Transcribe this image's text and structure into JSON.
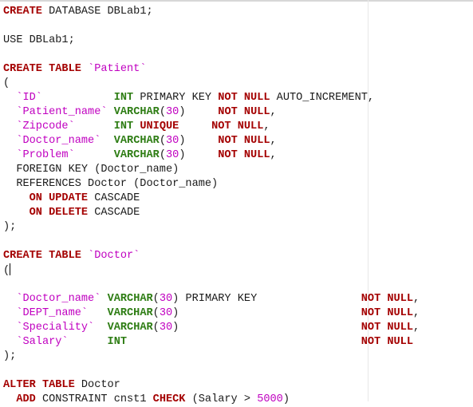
{
  "editor": {
    "colors": {
      "keyword": "#a40000",
      "type": "#2e7d14",
      "identifier": "#c000c0",
      "number": "#c000c0",
      "plain": "#1a1a1a"
    },
    "cursor_line": 19,
    "lines": [
      [
        [
          "k",
          "CREATE"
        ],
        [
          "p",
          " DATABASE DBLab1;"
        ]
      ],
      [],
      [
        [
          "p",
          "USE DBLab1;"
        ]
      ],
      [],
      [
        [
          "k",
          "CREATE TABLE"
        ],
        [
          "p",
          " "
        ],
        [
          "i",
          "`Patient`"
        ]
      ],
      [
        [
          "p",
          "("
        ]
      ],
      [
        [
          "p",
          "  "
        ],
        [
          "i",
          "`ID`"
        ],
        [
          "p",
          "           "
        ],
        [
          "t",
          "INT"
        ],
        [
          "p",
          " PRIMARY KEY "
        ],
        [
          "k",
          "NOT NULL"
        ],
        [
          "p",
          " AUTO_INCREMENT,"
        ]
      ],
      [
        [
          "p",
          "  "
        ],
        [
          "i",
          "`Patient_name`"
        ],
        [
          "p",
          " "
        ],
        [
          "t",
          "VARCHAR"
        ],
        [
          "p",
          "("
        ],
        [
          "n",
          "30"
        ],
        [
          "p",
          ")     "
        ],
        [
          "k",
          "NOT NULL"
        ],
        [
          "p",
          ","
        ]
      ],
      [
        [
          "p",
          "  "
        ],
        [
          "i",
          "`Zipcode`"
        ],
        [
          "p",
          "      "
        ],
        [
          "t",
          "INT"
        ],
        [
          "p",
          " "
        ],
        [
          "k",
          "UNIQUE"
        ],
        [
          "p",
          "     "
        ],
        [
          "k",
          "NOT NULL"
        ],
        [
          "p",
          ","
        ]
      ],
      [
        [
          "p",
          "  "
        ],
        [
          "i",
          "`Doctor_name`"
        ],
        [
          "p",
          "  "
        ],
        [
          "t",
          "VARCHAR"
        ],
        [
          "p",
          "("
        ],
        [
          "n",
          "30"
        ],
        [
          "p",
          ")     "
        ],
        [
          "k",
          "NOT NULL"
        ],
        [
          "p",
          ","
        ]
      ],
      [
        [
          "p",
          "  "
        ],
        [
          "i",
          "`Problem`"
        ],
        [
          "p",
          "      "
        ],
        [
          "t",
          "VARCHAR"
        ],
        [
          "p",
          "("
        ],
        [
          "n",
          "30"
        ],
        [
          "p",
          ")     "
        ],
        [
          "k",
          "NOT NULL"
        ],
        [
          "p",
          ","
        ]
      ],
      [
        [
          "p",
          "  FOREIGN KEY (Doctor_name)"
        ]
      ],
      [
        [
          "p",
          "  REFERENCES Doctor (Doctor_name)"
        ]
      ],
      [
        [
          "p",
          "    "
        ],
        [
          "k",
          "ON UPDATE"
        ],
        [
          "p",
          " CASCADE"
        ]
      ],
      [
        [
          "p",
          "    "
        ],
        [
          "k",
          "ON DELETE"
        ],
        [
          "p",
          " CASCADE"
        ]
      ],
      [
        [
          "p",
          ");"
        ]
      ],
      [],
      [
        [
          "k",
          "CREATE TABLE"
        ],
        [
          "p",
          " "
        ],
        [
          "i",
          "`Doctor`"
        ]
      ],
      [
        [
          "p",
          "("
        ]
      ],
      [],
      [
        [
          "p",
          "  "
        ],
        [
          "i",
          "`Doctor_name`"
        ],
        [
          "p",
          " "
        ],
        [
          "t",
          "VARCHAR"
        ],
        [
          "p",
          "("
        ],
        [
          "n",
          "30"
        ],
        [
          "p",
          ") PRIMARY KEY                "
        ],
        [
          "k",
          "NOT NULL"
        ],
        [
          "p",
          ","
        ]
      ],
      [
        [
          "p",
          "  "
        ],
        [
          "i",
          "`DEPT_name`"
        ],
        [
          "p",
          "   "
        ],
        [
          "t",
          "VARCHAR"
        ],
        [
          "p",
          "("
        ],
        [
          "n",
          "30"
        ],
        [
          "p",
          ")                            "
        ],
        [
          "k",
          "NOT NULL"
        ],
        [
          "p",
          ","
        ]
      ],
      [
        [
          "p",
          "  "
        ],
        [
          "i",
          "`Speciality`"
        ],
        [
          "p",
          "  "
        ],
        [
          "t",
          "VARCHAR"
        ],
        [
          "p",
          "("
        ],
        [
          "n",
          "30"
        ],
        [
          "p",
          ")                            "
        ],
        [
          "k",
          "NOT NULL"
        ],
        [
          "p",
          ","
        ]
      ],
      [
        [
          "p",
          "  "
        ],
        [
          "i",
          "`Salary`"
        ],
        [
          "p",
          "      "
        ],
        [
          "t",
          "INT"
        ],
        [
          "p",
          "                                    "
        ],
        [
          "k",
          "NOT NULL"
        ]
      ],
      [
        [
          "p",
          ");"
        ]
      ],
      [],
      [
        [
          "k",
          "ALTER TABLE"
        ],
        [
          "p",
          " Doctor"
        ]
      ],
      [
        [
          "p",
          "  "
        ],
        [
          "k",
          "ADD"
        ],
        [
          "p",
          " CONSTRAINT cnst1 "
        ],
        [
          "k",
          "CHECK"
        ],
        [
          "p",
          " (Salary > "
        ],
        [
          "n",
          "5000"
        ],
        [
          "p",
          ")"
        ]
      ]
    ]
  }
}
